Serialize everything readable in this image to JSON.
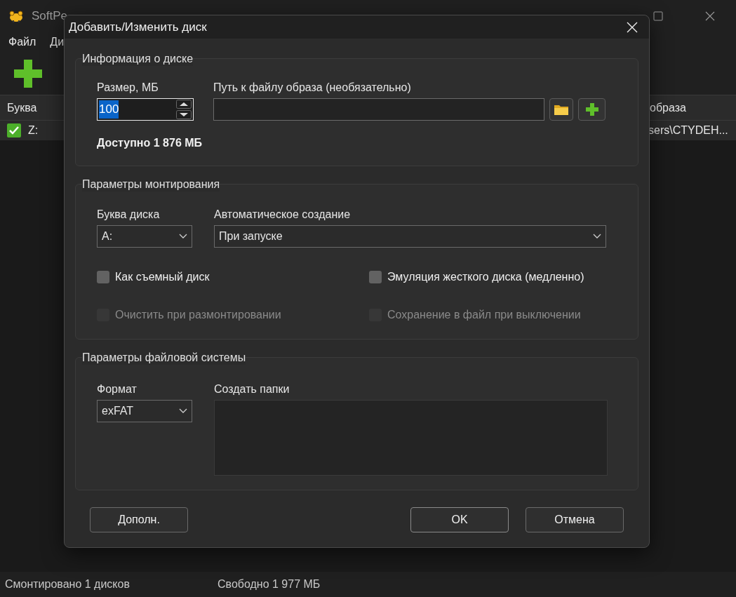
{
  "main_window": {
    "title": "SoftPe",
    "menu": [
      "Файл",
      "Ди"
    ],
    "table": {
      "columns": [
        "Буква",
        "образа"
      ],
      "rows": [
        {
          "checked": true,
          "letter": "Z:",
          "image": "sers\\CTYDEH..."
        }
      ]
    },
    "status_bar": [
      "Смонтировано 1 дисков",
      "Свободно 1 977 МБ"
    ]
  },
  "dialog": {
    "title": "Добавить/Изменить диск",
    "disk_info": {
      "legend": "Информация о диске",
      "size_label": "Размер, МБ",
      "size_value": "100",
      "path_label": "Путь к файлу образа (необязательно)",
      "available": "Доступно 1 876 МБ"
    },
    "mount": {
      "legend": "Параметры монтирования",
      "letter_label": "Буква диска",
      "letter_value": "A:",
      "auto_label": "Автоматическое создание",
      "auto_value": "При запуске",
      "options": [
        {
          "label": "Как съемный диск",
          "checked": false,
          "disabled": false
        },
        {
          "label": "Эмуляция жесткого диска (медленно)",
          "checked": false,
          "disabled": false
        },
        {
          "label": "Очистить при размонтировании",
          "checked": false,
          "disabled": true
        },
        {
          "label": "Сохранение в файл при выключении",
          "checked": false,
          "disabled": true
        }
      ]
    },
    "fs": {
      "legend": "Параметры файловой системы",
      "format_label": "Формат",
      "format_value": "exFAT",
      "folders_label": "Создать папки"
    },
    "buttons": [
      {
        "label": "Дополн.",
        "kind": "secondary"
      },
      {
        "label": "OK",
        "kind": "primary"
      },
      {
        "label": "Отмена",
        "kind": "secondary"
      }
    ]
  }
}
